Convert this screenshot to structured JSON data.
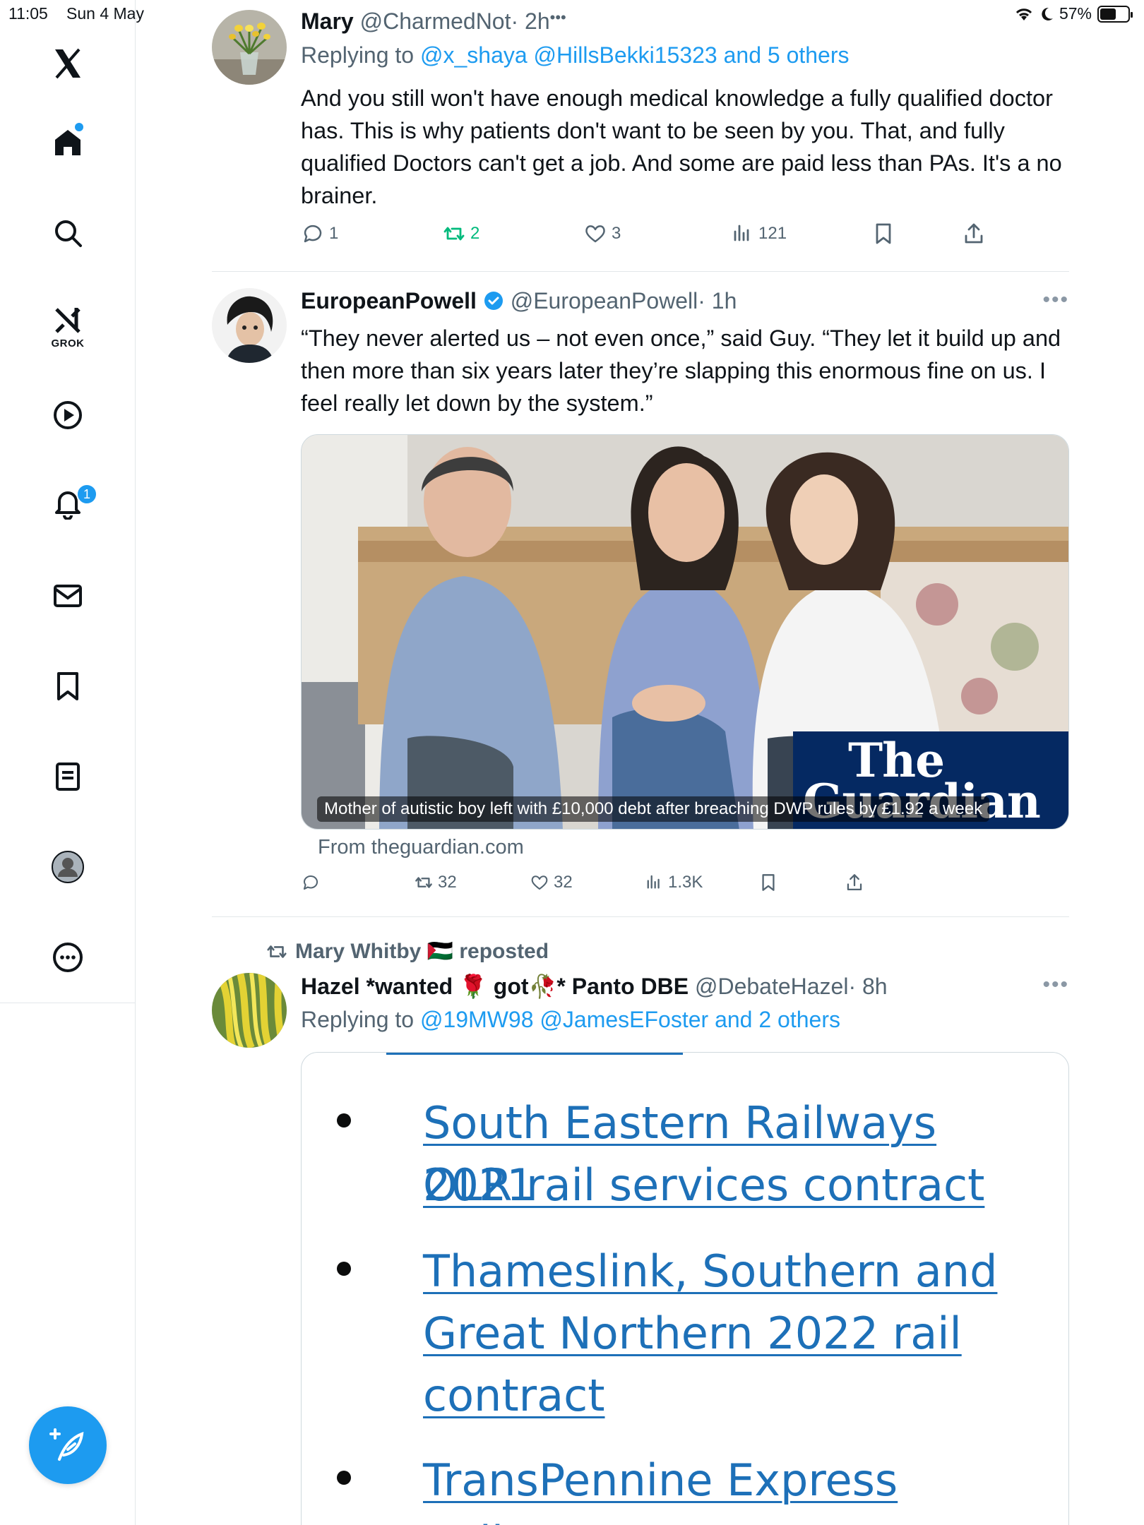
{
  "status_bar": {
    "time": "11:05",
    "date": "Sun 4 May",
    "battery": "57%",
    "battery_level": 0.57
  },
  "sidebar": {
    "grok_label": "GROK",
    "notifications_badge": "1",
    "items": [
      "x-logo",
      "home-icon",
      "search-icon",
      "grok-icon",
      "video-icon",
      "bell-icon",
      "mail-icon",
      "bookmark-icon",
      "lists-icon",
      "profile-icon",
      "more-icon"
    ]
  },
  "tweets": [
    {
      "name": "Mary",
      "handle": "@CharmedNot",
      "time": "· 2h",
      "replying_prefix": "Replying to ",
      "replying_links": "@x_shaya @HillsBekki15323 and 5 others",
      "text": "And you still won't have enough medical knowledge a fully qualified doctor has.  This is why patients don't want to be seen by you.  That, and fully qualified Doctors can't get a job.  And some are paid less than PAs.  It's a no brainer.",
      "replies": "1",
      "reposts": "2",
      "likes": "3",
      "views": "121",
      "more": "•••"
    },
    {
      "name": "EuropeanPowell",
      "handle": "@EuropeanPowell",
      "time": "· 1h",
      "text": "“They never alerted us – not even once,” said Guy. “They let it build up and then more than six years later they’re slapping this enormous fine on us. I feel really let down by the system.”",
      "card_caption": "Mother of autistic boy left with £10,000 debt after breaching DWP rules by £1.92 a week",
      "card_logo_line1": "The",
      "card_logo_line2": "Guardian",
      "card_source": "From theguardian.com",
      "replies": "",
      "reposts": "32",
      "likes": "32",
      "views": "1.3K",
      "more": "•••"
    },
    {
      "reposted_by": "Mary Whitby 🇵🇸 reposted",
      "name": "Hazel *wanted 🌹 got🥀* Panto DBE",
      "handle": "@DebateHazel",
      "time": "· 8h",
      "replying_prefix": "Replying to ",
      "replying_links": "@19MW98 @JamesEFoster and 2 others",
      "more": "•••",
      "doc_links": [
        "South Eastern Railways 2021",
        "OLR rail services contract",
        "Thameslink, Southern and",
        "Great Northern 2022 rail",
        "contract",
        "TransPennine Express Railways"
      ]
    }
  ],
  "colors": {
    "accent": "#1d9bf0",
    "repost_green": "#00ba7c",
    "guardian_blue": "#052962",
    "gov_link": "#1d70b8"
  }
}
